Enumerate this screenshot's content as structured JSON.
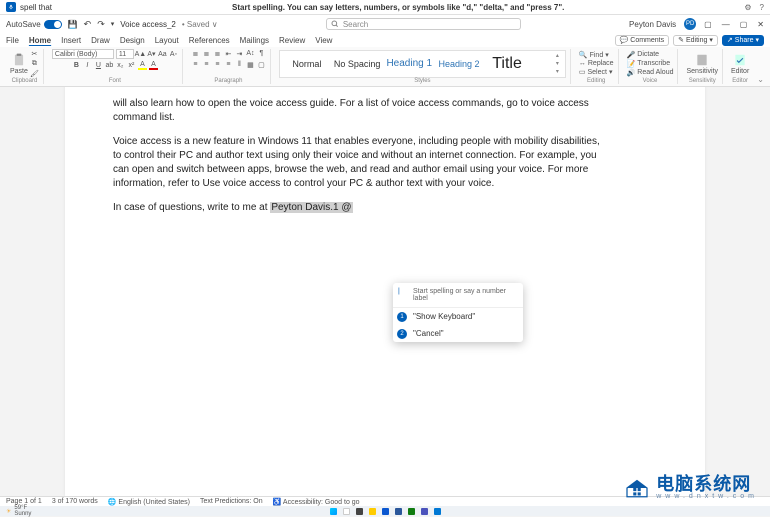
{
  "voice_access": {
    "command": "spell that",
    "hint": "Start spelling. You can say letters, numbers, or symbols like \"d,\" \"delta,\" and \"press 7\"."
  },
  "window": {
    "autosave_label": "AutoSave",
    "file_name": "Voice access_2",
    "save_state": "• Saved ∨",
    "search_placeholder": "Search",
    "user_name": "Peyton Davis",
    "user_initials": "PD"
  },
  "tabs": {
    "file": "File",
    "home": "Home",
    "insert": "Insert",
    "draw": "Draw",
    "design": "Design",
    "layout": "Layout",
    "references": "References",
    "mailings": "Mailings",
    "review": "Review",
    "view": "View",
    "comments": "Comments",
    "editing": "Editing",
    "share": "Share"
  },
  "ribbon": {
    "paste": "Paste",
    "clipboard": "Clipboard",
    "font_name": "Calibri (Body)",
    "font_size": "11",
    "font_group": "Font",
    "para_group": "Paragraph",
    "styles_group": "Styles",
    "style_normal": "Normal",
    "style_nospace": "No Spacing",
    "style_h1": "Heading 1",
    "style_h2": "Heading 2",
    "style_title": "Title",
    "find": "Find",
    "replace": "Replace",
    "select": "Select",
    "editing_group": "Editing",
    "dictate": "Dictate",
    "transcribe": "Transcribe",
    "read_aloud": "Read Aloud",
    "voice_group": "Voice",
    "sensitivity": "Sensitivity",
    "sens_group": "Sensitivity",
    "editor": "Editor",
    "editor_group": "Editor"
  },
  "doc": {
    "p1": "will also learn how to open the voice access guide. For a list of voice access commands, go to voice access command list.",
    "p2": "Voice access is a new feature in Windows 11 that enables everyone, including people with mobility disabilities, to control their PC and author text using only their voice and without an internet connection. For example, you can open and switch between apps, browse the web, and read and author email using your voice. For more information, refer to Use voice access to control your PC & author text with your voice.",
    "p3_prefix": "In case of questions, write to me at ",
    "p3_highlight": "Peyton Davis.1 @"
  },
  "popup": {
    "hint": "Start spelling or say a number label",
    "opt1": "\"Show Keyboard\"",
    "opt2": "\"Cancel\""
  },
  "status": {
    "page": "Page 1 of 1",
    "words": "3 of 170 words",
    "lang": "English (United States)",
    "predictions": "Text Predictions: On",
    "accessibility": "Accessibility: Good to go"
  },
  "watermark": {
    "cn": "电脑系统网",
    "url": "www.dnxtw.com"
  },
  "weather": {
    "temp": "59°F",
    "cond": "Sunny"
  }
}
